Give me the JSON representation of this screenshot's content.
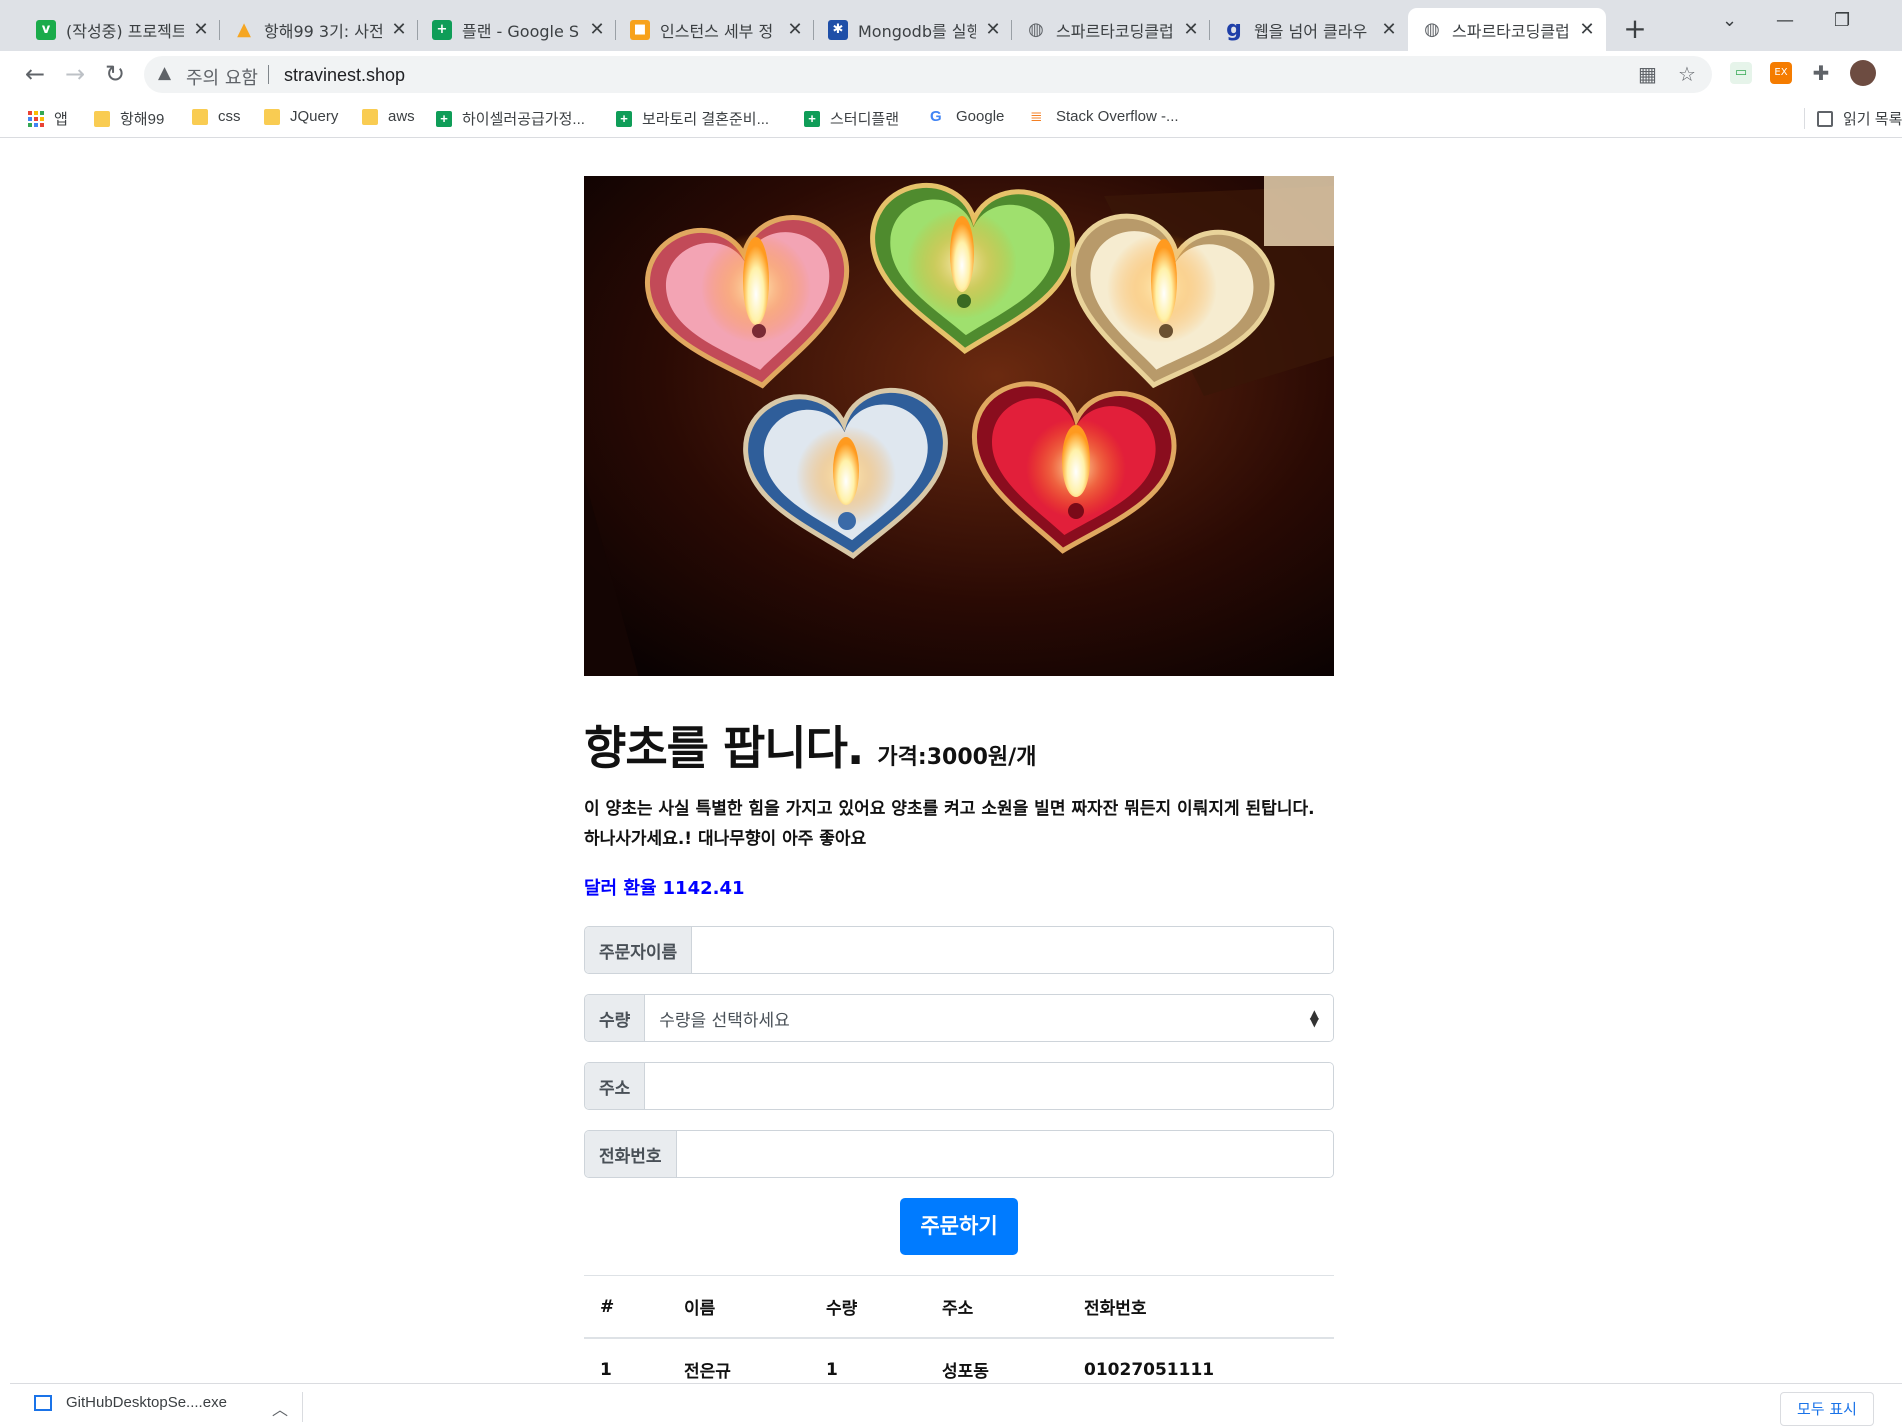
{
  "browser": {
    "tabs": [
      {
        "title": "(작성중) 프로젝트",
        "favicon": "vrew-icon",
        "color": "#1aab4a",
        "glyph": "v"
      },
      {
        "title": "항해99 3기: 사전",
        "favicon": "notion-triangle-icon",
        "color": "#f5a623",
        "glyph": "▲"
      },
      {
        "title": "플랜 - Google Sh",
        "favicon": "sheets-icon",
        "color": "#0f9d58",
        "glyph": "+"
      },
      {
        "title": "인스턴스 세부 정",
        "favicon": "aws-box-icon",
        "color": "#f7a21b",
        "glyph": "■"
      },
      {
        "title": "Mongodb를 실행",
        "favicon": "network-icon",
        "color": "#1f4fa8",
        "glyph": "✱"
      },
      {
        "title": "스파르타코딩클럽",
        "favicon": "globe-icon",
        "color": "#5f6368",
        "glyph": "◍"
      },
      {
        "title": "웹을 넘어 클라우",
        "favicon": "g-dot-icon",
        "color": "#1f3fa8",
        "glyph": "g"
      },
      {
        "title": "스파르타코딩클럽",
        "favicon": "globe-icon",
        "color": "#5f6368",
        "glyph": "◍",
        "active": true
      }
    ],
    "new_tab": "+",
    "address": {
      "security_label": "주의 요함",
      "url": "stravinest.shop"
    },
    "bookmarks": [
      {
        "label": "앱",
        "kind": "apps"
      },
      {
        "label": "항해99",
        "kind": "folder"
      },
      {
        "label": "css",
        "kind": "folder"
      },
      {
        "label": "JQuery",
        "kind": "folder"
      },
      {
        "label": "aws",
        "kind": "folder"
      },
      {
        "label": "하이셀러공급가정...",
        "kind": "sheets"
      },
      {
        "label": "보라토리 결혼준비...",
        "kind": "sheets"
      },
      {
        "label": "스터디플랜",
        "kind": "sheets"
      },
      {
        "label": "Google",
        "kind": "google"
      },
      {
        "label": "Stack Overflow -...",
        "kind": "stackoverflow"
      },
      {
        "label": "읽기 목록",
        "kind": "reading-list"
      }
    ]
  },
  "page": {
    "title": "향초를 팝니다.",
    "price": "가격:3000원/개",
    "description": "이 양초는 사실 특별한 힘을 가지고 있어요 양초를 켜고 소원을 빌면 짜자잔 뭐든지 이뤄지게 된탑니다. 하나사가세요.! 대나무향이 아주 좋아요",
    "rate_label": "달러 환율",
    "rate_value": "1142.41",
    "form": {
      "name_label": "주문자이름",
      "name_value": "",
      "qty_label": "수량",
      "qty_selected": "수량을 선택하세요",
      "address_label": "주소",
      "address_value": "",
      "phone_label": "전화번호",
      "phone_value": ""
    },
    "order_button": "주문하기",
    "table": {
      "headers": [
        "#",
        "이름",
        "수량",
        "주소",
        "전화번호"
      ],
      "rows": [
        [
          "1",
          "전은규",
          "1",
          "성포동",
          "01027051111"
        ]
      ]
    }
  },
  "downloads": {
    "file": "GitHubDesktopSe....exe",
    "show_all": "모두 표시"
  },
  "colors": {
    "accent": "#007bff",
    "rate": "#0000ff"
  }
}
